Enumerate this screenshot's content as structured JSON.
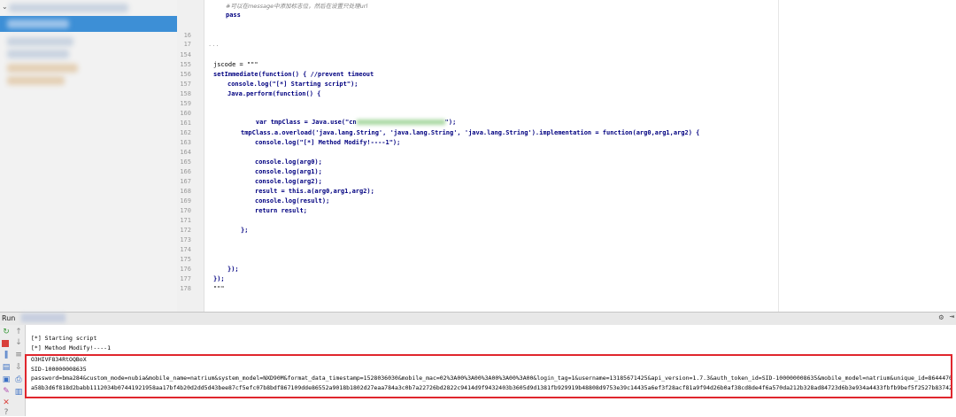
{
  "editor": {
    "line_numbers": [
      "",
      "",
      "16",
      "17",
      "",
      "154",
      "155",
      "156",
      "157",
      "158",
      "159",
      "160",
      "161",
      "162",
      "163",
      "164",
      "165",
      "166",
      "167",
      "168",
      "169",
      "170",
      "171",
      "172",
      "173",
      "174",
      "175",
      "176",
      "177",
      "178"
    ],
    "lines": {
      "l0": "#可以在message中添加标志位，然后在设置只处理url",
      "l1": "pass",
      "l4": "...",
      "l6": "jscode = \"\"\"",
      "l7": "setImmediate(function() { //prevent timeout",
      "l8": "console.log(\"[*] Starting script\");",
      "l9": "Java.perform(function() {",
      "l11_a": "var tmpClass = Java.use(\"cn",
      "l11_b": "\");",
      "l13": "tmpClass.a.overload('java.lang.String', 'java.lang.String', 'java.lang.String').implementation = function(arg0,arg1,arg2) {",
      "l14": "console.log(\"[*] Method Modify!----1\");",
      "l16": "console.log(arg0);",
      "l17": "console.log(arg1);",
      "l18": "console.log(arg2);",
      "l19": "result = this.a(arg0,arg1,arg2);",
      "l20": "console.log(result);",
      "l21": "return result;",
      "l23": "};",
      "l26": "});",
      "l27": "});",
      "l28": "\"\"\""
    }
  },
  "run": {
    "title": "Run",
    "gear": "⚙",
    "hide": "⇥",
    "output": [
      "[*] Starting script",
      "[*] Method Modify!----1",
      "O3HIVF834RtOQBoX",
      "SID-100000008635",
      "password=bma284&custom_mode=nubia&mobile_name=natrium&system_model=NXD90M&format_data_timestamp=1528036030&mobile_mac=02%3A00%3A00%3A00%3A00%3A00&login_tag=1&username=13185671425&api_version=1.7.3&auth_token_id=SID-100000008635&mobile_model=natrium&unique_id=864447036505384&lang=zh_CN&random_token=15280360",
      "a58b3d6f818d2babb1112034b07441921958aa17bf4b20d2dd5d43bee87cf5efc07b8bdf867109dde86552a9018b1802d27eaa784a3c0b7a22726bd2822c9414d9f9432403b3605d9d1381fb929919b48808d9753e39c14435a6ef3f28acf81a9f94d26b0af38cd8de4f6a570da212b328ad84723d6b3e934a4433fbfb9bef5f2527b8374227ede76208ea53ac7c02a53ff4121b31b0c"
    ]
  }
}
